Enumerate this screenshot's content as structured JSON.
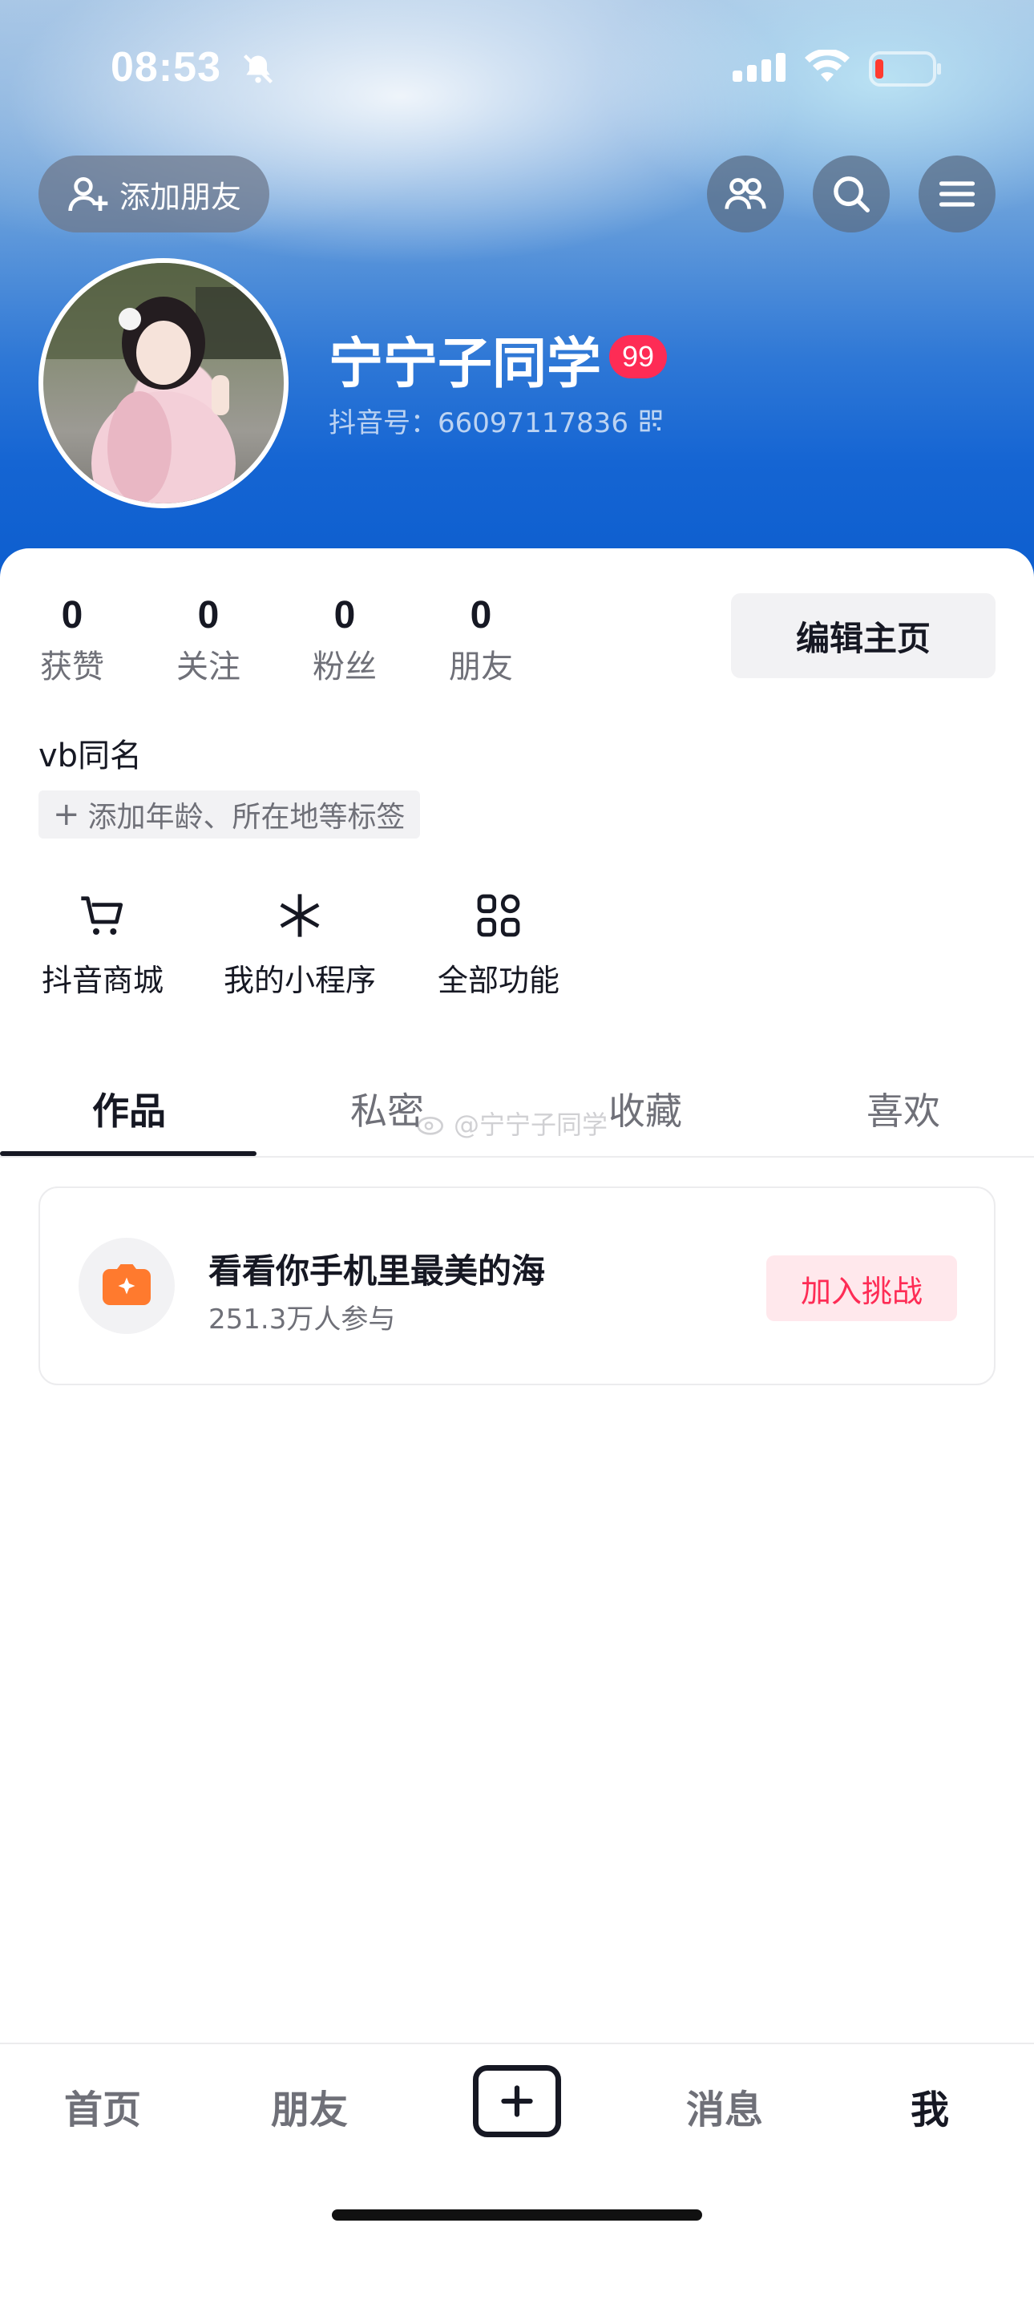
{
  "status_bar": {
    "time": "08:53"
  },
  "header": {
    "add_friend_label": "添加朋友",
    "username": "宁宁子同学",
    "badge_count": "99",
    "douyin_id": "抖音号：66097117836"
  },
  "stats": [
    {
      "value": "0",
      "label": "获赞"
    },
    {
      "value": "0",
      "label": "关注"
    },
    {
      "value": "0",
      "label": "粉丝"
    },
    {
      "value": "0",
      "label": "朋友"
    }
  ],
  "edit_profile_label": "编辑主页",
  "bio": "vb同名",
  "add_tag_label": "添加年龄、所在地等标签",
  "functions": [
    {
      "label": "抖音商城",
      "icon": "cart-icon"
    },
    {
      "label": "我的小程序",
      "icon": "asterisk-icon"
    },
    {
      "label": "全部功能",
      "icon": "grid-icon"
    }
  ],
  "tabs": [
    {
      "label": "作品",
      "active": true
    },
    {
      "label": "私密",
      "active": false
    },
    {
      "label": "收藏",
      "active": false
    },
    {
      "label": "喜欢",
      "active": false
    }
  ],
  "watermark": "@宁宁子同学",
  "challenge": {
    "title": "看看你手机里最美的海",
    "participants": "251.3万人参与",
    "join_label": "加入挑战"
  },
  "bottom_nav": [
    {
      "label": "首页",
      "active": false
    },
    {
      "label": "朋友",
      "active": false
    },
    {
      "label": "消息",
      "active": false
    },
    {
      "label": "我",
      "active": true
    }
  ],
  "colors": {
    "accent": "#fe2c55",
    "text": "#161823",
    "secondary": "#6f7078"
  }
}
